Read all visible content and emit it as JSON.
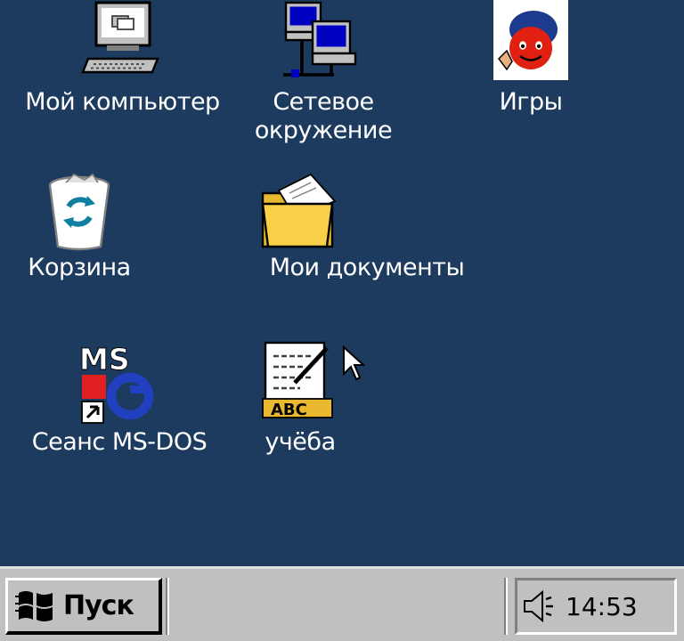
{
  "desktop": {
    "background_color": "#1c3b5e",
    "icons": [
      {
        "label": "Мой компьютер",
        "icon": "my-computer-icon"
      },
      {
        "label_line1": "Сетевое",
        "label_line2": "окружение",
        "icon": "network-neighborhood-icon"
      },
      {
        "label": "Игры",
        "icon": "games-icon"
      },
      {
        "label": "Корзина",
        "icon": "recycle-bin-icon"
      },
      {
        "label": "Мои документы",
        "icon": "my-documents-folder-icon"
      },
      {
        "label": "Сеанс MS-DOS",
        "icon": "ms-dos-prompt-icon"
      },
      {
        "label": "учёба",
        "icon": "document-abc-icon"
      }
    ]
  },
  "taskbar": {
    "start_label": "Пуск",
    "clock": "14:53",
    "tray_icon": "speaker-volume-icon"
  }
}
